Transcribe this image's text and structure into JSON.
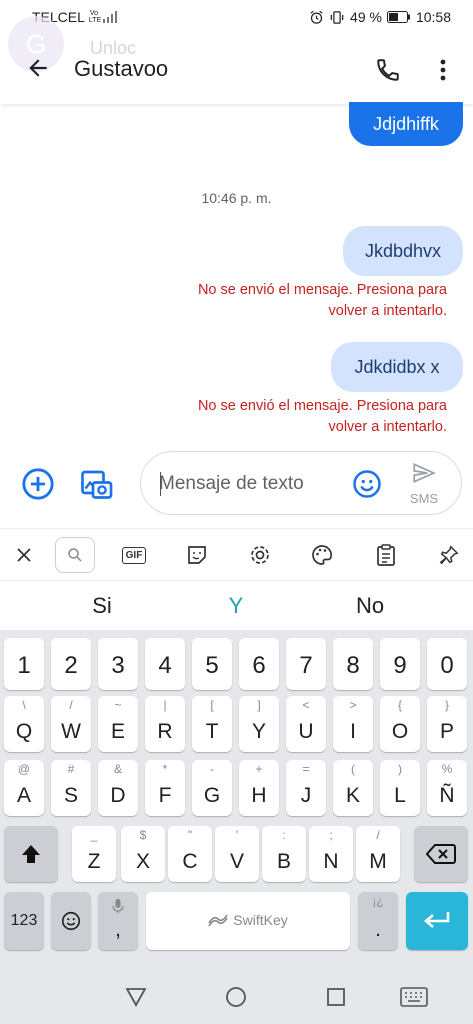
{
  "status_bar": {
    "carrier": "TELCEL",
    "network": "Vo LTE",
    "battery": "49 %",
    "time": "10:58"
  },
  "header": {
    "ghost_initial": "G",
    "ghost_text": "Unloc",
    "contact_name": "Gustavoo"
  },
  "messages": [
    {
      "text": "Jdjdhiffk",
      "status": ""
    },
    {
      "text": "Jkdbdhvx",
      "status": "No se envió el mensaje. Presiona para volver a intentarlo."
    },
    {
      "text": "Jdkdidbx x",
      "status": "No se envió el mensaje. Presiona para volver a intentarlo."
    }
  ],
  "timestamp": "10:46 p. m.",
  "error_lines": [
    "No se envió el mensaje. Presiona para",
    "volver a intentarlo."
  ],
  "compose": {
    "placeholder": "Mensaje de texto",
    "send_label": "SMS"
  },
  "keyboard_toolbar": {
    "gif_label": "GIF",
    "items": [
      "close-icon",
      "search-icon",
      "gif-icon",
      "sticker-icon",
      "settings-icon",
      "theme-icon",
      "clipboard-icon",
      "pin-icon"
    ]
  },
  "suggestions": [
    "Si",
    "Y",
    "No"
  ],
  "keyboard": {
    "number_row": [
      "1",
      "2",
      "3",
      "4",
      "5",
      "6",
      "7",
      "8",
      "9",
      "0"
    ],
    "row1": [
      {
        "main": "Q",
        "sub": "\\"
      },
      {
        "main": "W",
        "sub": "/"
      },
      {
        "main": "E",
        "sub": "~"
      },
      {
        "main": "R",
        "sub": "|"
      },
      {
        "main": "T",
        "sub": "["
      },
      {
        "main": "Y",
        "sub": "]"
      },
      {
        "main": "U",
        "sub": "<"
      },
      {
        "main": "I",
        "sub": ">"
      },
      {
        "main": "O",
        "sub": "{"
      },
      {
        "main": "P",
        "sub": "}"
      }
    ],
    "row2": [
      {
        "main": "A",
        "sub": "@"
      },
      {
        "main": "S",
        "sub": "#"
      },
      {
        "main": "D",
        "sub": "&"
      },
      {
        "main": "F",
        "sub": "*"
      },
      {
        "main": "G",
        "sub": "-"
      },
      {
        "main": "H",
        "sub": "+"
      },
      {
        "main": "J",
        "sub": "="
      },
      {
        "main": "K",
        "sub": "("
      },
      {
        "main": "L",
        "sub": ")"
      },
      {
        "main": "Ñ",
        "sub": "%"
      }
    ],
    "row3": [
      {
        "main": "Z",
        "sub": "_"
      },
      {
        "main": "X",
        "sub": "$"
      },
      {
        "main": "C",
        "sub": "\""
      },
      {
        "main": "V",
        "sub": "'"
      },
      {
        "main": "B",
        "sub": ":"
      },
      {
        "main": "N",
        "sub": ";"
      },
      {
        "main": "M",
        "sub": "/"
      }
    ],
    "num_switch": "123",
    "comma": ",",
    "period": ".",
    "period_sub": "¡¿",
    "space_label": "SwiftKey"
  },
  "colors": {
    "accent": "#1a73e8",
    "error": "#c5221f",
    "failed_bubble": "#d3e3fd",
    "enter_key": "#29b6d8",
    "suggestion_highlight": "#1aa3b5"
  }
}
